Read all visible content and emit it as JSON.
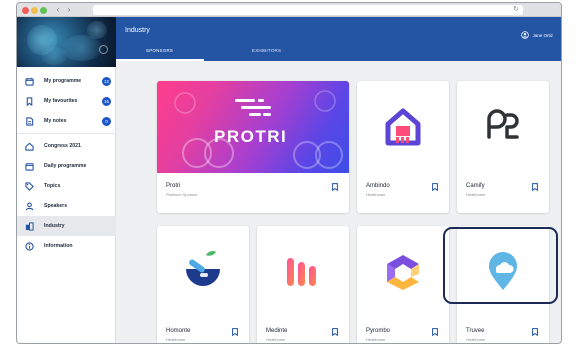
{
  "app": {
    "page_title": "Industry",
    "user_name": "Jane Ortiz"
  },
  "tabs": [
    {
      "label": "SPONSORS"
    },
    {
      "label": "EXHIBITORS"
    }
  ],
  "sidebar": {
    "items": [
      {
        "label": "My programme",
        "badge": "12",
        "icon": "calendar-icon"
      },
      {
        "label": "My favourites",
        "badge": "16",
        "icon": "bookmark-icon"
      },
      {
        "label": "My notes",
        "badge": "0",
        "icon": "note-icon"
      },
      {
        "label": "Congress 2021",
        "icon": "home-icon"
      },
      {
        "label": "Daily programme",
        "icon": "calendar-icon"
      },
      {
        "label": "Topics",
        "icon": "tag-icon"
      },
      {
        "label": "Speakers",
        "icon": "person-icon"
      },
      {
        "label": "Industry",
        "icon": "building-icon"
      },
      {
        "label": "Information",
        "icon": "info-icon"
      }
    ]
  },
  "cards": [
    {
      "name": "Protri",
      "category": "Platinum Sponsor",
      "logo_text": "PROTRI"
    },
    {
      "name": "Ambindo",
      "category": "Healthcare"
    },
    {
      "name": "Camify",
      "category": "Healthcare"
    },
    {
      "name": "Homonte",
      "category": "Healthcare"
    },
    {
      "name": "Medinte",
      "category": "Healthcare"
    },
    {
      "name": "Pyrombo",
      "category": "Healthcare"
    },
    {
      "name": "Truvee",
      "category": "Healthcare"
    }
  ],
  "colors": {
    "header": "#2454a4",
    "badge": "#1b55c7",
    "highlight": "#1b2b55"
  }
}
